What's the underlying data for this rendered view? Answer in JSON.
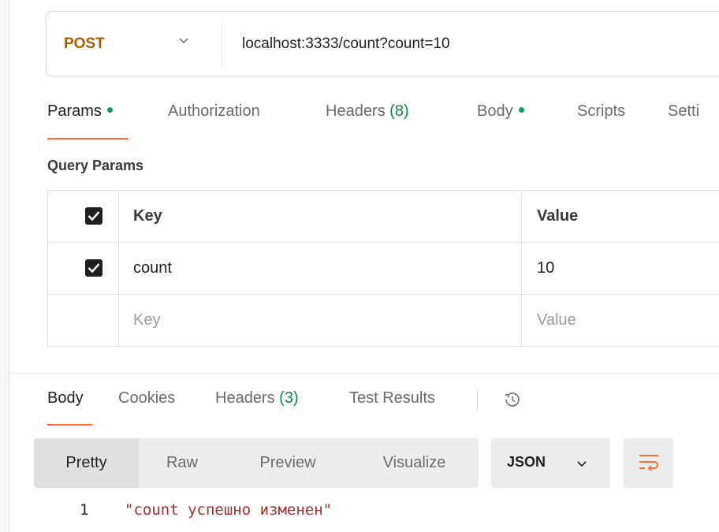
{
  "request": {
    "method": "POST",
    "url": "localhost:3333/count?count=10"
  },
  "request_tabs": [
    {
      "label": "Params",
      "dot": true,
      "active": true
    },
    {
      "label": "Authorization"
    },
    {
      "label": "Headers",
      "count": "(8)"
    },
    {
      "label": "Body",
      "dot": true
    },
    {
      "label": "Scripts"
    },
    {
      "label": "Setti"
    }
  ],
  "query_params": {
    "title": "Query Params",
    "header": {
      "key": "Key",
      "value": "Value",
      "checked": true
    },
    "rows": [
      {
        "key": "count",
        "value": "10",
        "checked": true
      }
    ],
    "placeholder": {
      "key": "Key",
      "value": "Value"
    }
  },
  "response_tabs": [
    {
      "label": "Body",
      "active": true
    },
    {
      "label": "Cookies"
    },
    {
      "label": "Headers",
      "count": "(3)"
    },
    {
      "label": "Test Results"
    }
  ],
  "response_toolbar": {
    "modes": [
      "Pretty",
      "Raw",
      "Preview",
      "Visualize"
    ],
    "active_mode": "Pretty",
    "format": "JSON",
    "icons": [
      "history-icon",
      "chevron-down-icon",
      "word-wrap-icon"
    ]
  },
  "response_body": {
    "line_number": "1",
    "text": "\"count успешно изменен\""
  },
  "colors": {
    "method": "#a55f00",
    "accent": "#ff6c37",
    "dot": "#0f9d58",
    "string": "#a0302e"
  }
}
